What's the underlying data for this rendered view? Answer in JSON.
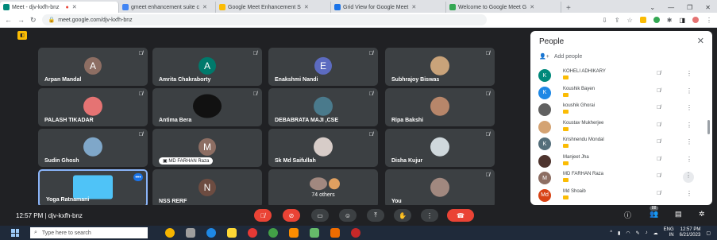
{
  "browser": {
    "tabs": [
      {
        "label": "Meet - djv-kxfh-bnz",
        "color": "#00897b",
        "active": true
      },
      {
        "label": "gmeet enhancement suite c",
        "color": "#4285f4"
      },
      {
        "label": "Google Meet Enhancement S",
        "color": "#fbbc04"
      },
      {
        "label": "Grid View for Google Meet",
        "color": "#1a73e8"
      },
      {
        "label": "Welcome to Google Meet G",
        "color": "#34a853"
      }
    ],
    "new_tab": "+",
    "url": "meet.google.com/djv-kxfh-bnz"
  },
  "meet": {
    "tiles": [
      {
        "name": "Arpan Mandal",
        "kind": "avatar",
        "initial": "A",
        "color": "#8d6e63"
      },
      {
        "name": "Amrita Chakraborty",
        "kind": "avatar",
        "initial": "A",
        "color": "#00796b"
      },
      {
        "name": "Enakshmi Nandi",
        "kind": "avatar",
        "initial": "E",
        "color": "#5c6bc0"
      },
      {
        "name": "Subhrajoy Biswas",
        "kind": "photo",
        "color": "#c9a37a"
      },
      {
        "name": "PALASH TIKADAR",
        "kind": "photo",
        "color": "#e57373"
      },
      {
        "name": "Antima Bera",
        "kind": "photo",
        "color": "#111111"
      },
      {
        "name": "DEBABRATA MAJI ,CSE",
        "kind": "photo",
        "color": "#4a7a8c"
      },
      {
        "name": "Ripa Bakshi",
        "kind": "photo",
        "color": "#b7866a"
      },
      {
        "name": "Sudin Ghosh",
        "kind": "photo",
        "color": "#7fa7c9"
      },
      {
        "name": "MD FARHAN Raza",
        "kind": "avatar",
        "initial": "M",
        "color": "#8d6e63"
      },
      {
        "name": "Sk Md Saifullah",
        "kind": "photo",
        "color": "#d7ccc8"
      },
      {
        "name": "Disha Kujur",
        "kind": "photo",
        "color": "#cfd8dc"
      },
      {
        "name": "Yoga Ratnamani",
        "kind": "photo",
        "color": "#4fc3f7"
      },
      {
        "name": "NSS RERF",
        "kind": "avatar",
        "initial": "N",
        "color": "#6d4c41"
      },
      {
        "name": "74 others",
        "kind": "group",
        "color": "#a1887f"
      },
      {
        "name": "You",
        "kind": "photo",
        "color": "#a1887f"
      }
    ],
    "time": "12:57 PM",
    "meeting_code": "djv-kxfh-bnz",
    "separator": "|",
    "participant_count": "88"
  },
  "people": {
    "title": "People",
    "add_label": "Add people",
    "list": [
      {
        "name": "KOHELI ADHIKARY",
        "initial": "K",
        "color": "#00897b"
      },
      {
        "name": "Koushik Bayen",
        "initial": "K",
        "color": "#1e88e5"
      },
      {
        "name": "koushik Ghorai",
        "initial": "",
        "color": "#616161"
      },
      {
        "name": "Koustav Mukherjee",
        "initial": "",
        "color": "#d4a373"
      },
      {
        "name": "Krishnendu Mondal",
        "initial": "K",
        "color": "#546e7a"
      },
      {
        "name": "Manjeet Jha",
        "initial": "",
        "color": "#4e342e"
      },
      {
        "name": "MD FARHAN Raza",
        "initial": "M",
        "color": "#8d6e63"
      },
      {
        "name": "Md Shoaib",
        "initial": "Md",
        "color": "#d84315"
      }
    ]
  },
  "taskbar": {
    "search_placeholder": "Type here to search",
    "lang": "ENG",
    "region": "IN",
    "time": "12:57 PM",
    "date": "6/21/2023"
  }
}
